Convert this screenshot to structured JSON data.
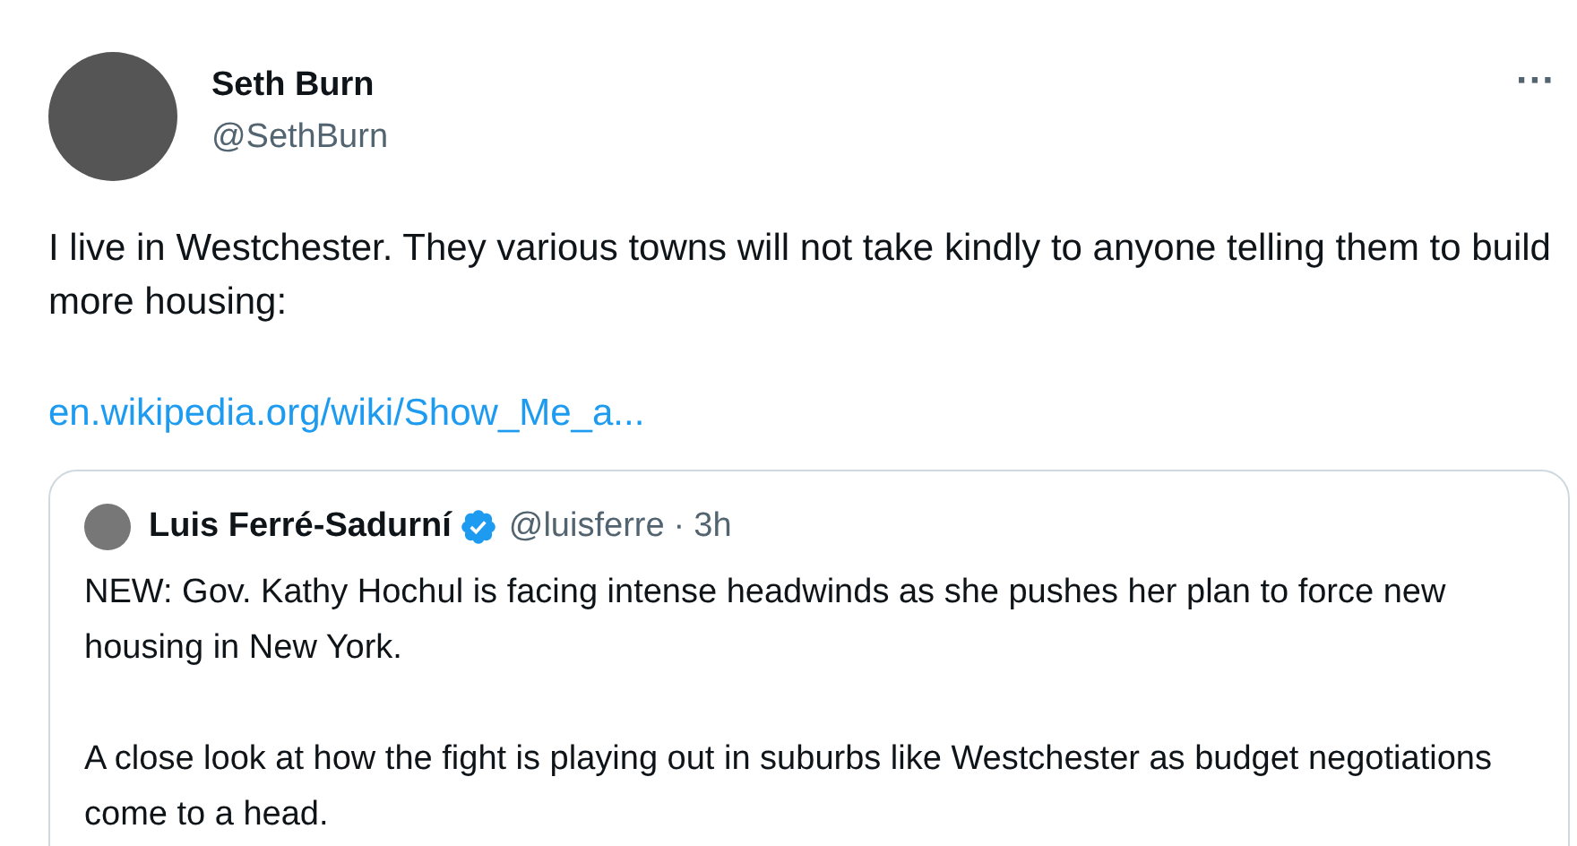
{
  "author": {
    "name": "Seth Burn",
    "handle": "@SethBurn"
  },
  "more": "···",
  "body": [
    "I live in Westchester. They various towns will not take kindly to anyone telling them to build more housing:"
  ],
  "link": "en.wikipedia.org/wiki/Show_Me_a...",
  "quote": {
    "name": "Luis Ferré-Sadurní",
    "verified": true,
    "handle": "@luisferre",
    "separator": "·",
    "time": "3h",
    "paragraphs": [
      "NEW: Gov. Kathy Hochul is facing intense headwinds as she pushes her plan to force new housing in New York.",
      "A close look at how the fight is playing out in suburbs like Westchester as budget negotiations come to a head."
    ]
  }
}
